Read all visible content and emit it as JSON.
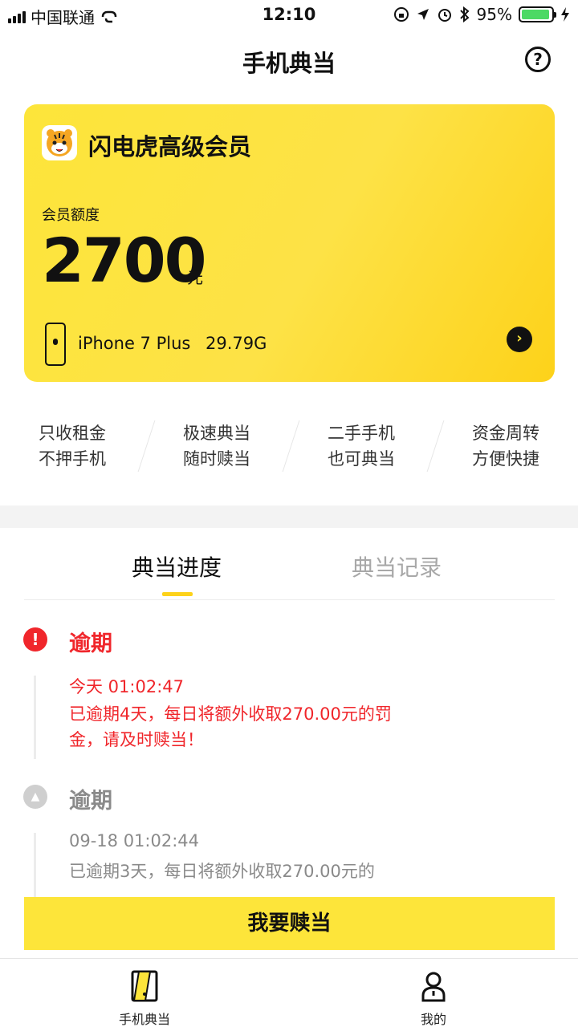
{
  "status_bar": {
    "carrier": "中国联通",
    "time": "12:10",
    "battery": "95%",
    "battery_level": 0.95
  },
  "header": {
    "title": "手机典当",
    "help_glyph": "?"
  },
  "card": {
    "title": "闪电虎高级会员",
    "label": "会员额度",
    "amount": "2700",
    "unit": "元",
    "device_name": "iPhone 7 Plus",
    "device_storage": "29.79G",
    "colors": {
      "start": "#fde53a",
      "end": "#fdd21a"
    }
  },
  "features": [
    {
      "line1": "只收租金",
      "line2": "不押手机"
    },
    {
      "line1": "极速典当",
      "line2": "随时赎当"
    },
    {
      "line1": "二手手机",
      "line2": "也可典当"
    },
    {
      "line1": "资金周转",
      "line2": "方便快捷"
    }
  ],
  "tabs": {
    "active": "典当进度",
    "inactive": "典当记录"
  },
  "timeline": [
    {
      "status": "逾期",
      "time": "今天 01:02:47",
      "message": "已逾期4天，每日将额外收取270.00元的罚金，请及时赎当！",
      "color": "#f0262b",
      "icon": "alert-icon"
    },
    {
      "status": "逾期",
      "time": "09-18 01:02:44",
      "message": "已逾期3天，每日将额外收取270.00元的",
      "color": "#8a8a8a",
      "icon": "chevron-up-icon"
    }
  ],
  "redeem_button": "我要赎当",
  "bottom_nav": [
    {
      "label": "手机典当",
      "icon": "phone-pawn-icon"
    },
    {
      "label": "我的",
      "icon": "profile-icon"
    }
  ]
}
